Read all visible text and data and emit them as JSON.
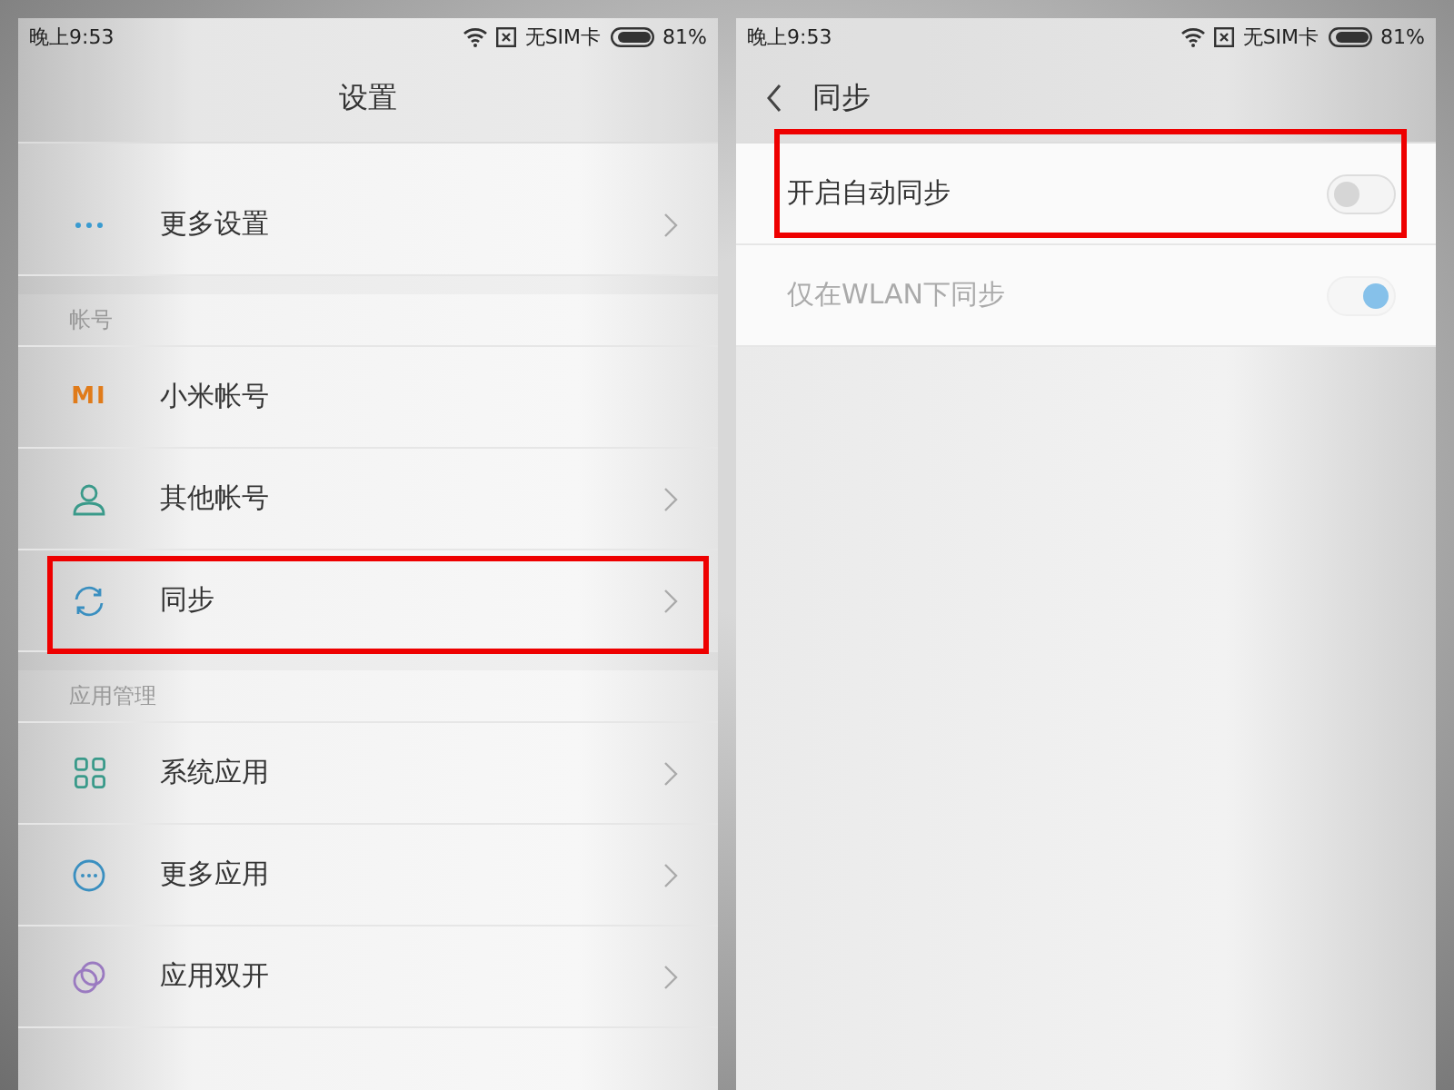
{
  "left_screen": {
    "status_bar": {
      "time": "晚上9:53",
      "carrier": "无SIM卡",
      "battery": "81%"
    },
    "header": {
      "title": "设置"
    },
    "sections": [
      {
        "items": [
          {
            "kind": "dots",
            "label": "更多设置",
            "chevron": true,
            "highlighted": false
          }
        ]
      },
      {
        "title": "帐号",
        "items": [
          {
            "kind": "mi",
            "logo_text": "MI",
            "label": "小米帐号",
            "chevron": false,
            "highlighted": false
          },
          {
            "kind": "person",
            "label": "其他帐号",
            "chevron": true,
            "highlighted": false
          },
          {
            "kind": "sync",
            "label": "同步",
            "chevron": true,
            "highlighted": true
          }
        ]
      },
      {
        "title": "应用管理",
        "items": [
          {
            "kind": "grid",
            "label": "系统应用",
            "chevron": true,
            "highlighted": false
          },
          {
            "kind": "circle-dots",
            "label": "更多应用",
            "chevron": true,
            "highlighted": false
          },
          {
            "kind": "circles",
            "label": "应用双开",
            "chevron": true,
            "highlighted": false
          }
        ]
      }
    ]
  },
  "right_screen": {
    "status_bar": {
      "time": "晚上9:53",
      "carrier": "无SIM卡",
      "battery": "81%"
    },
    "header": {
      "title": "同步"
    },
    "toggles": [
      {
        "label": "开启自动同步",
        "on": false,
        "disabled": false,
        "highlighted": true
      },
      {
        "label": "仅在WLAN下同步",
        "on": true,
        "disabled": true,
        "highlighted": false
      }
    ]
  }
}
